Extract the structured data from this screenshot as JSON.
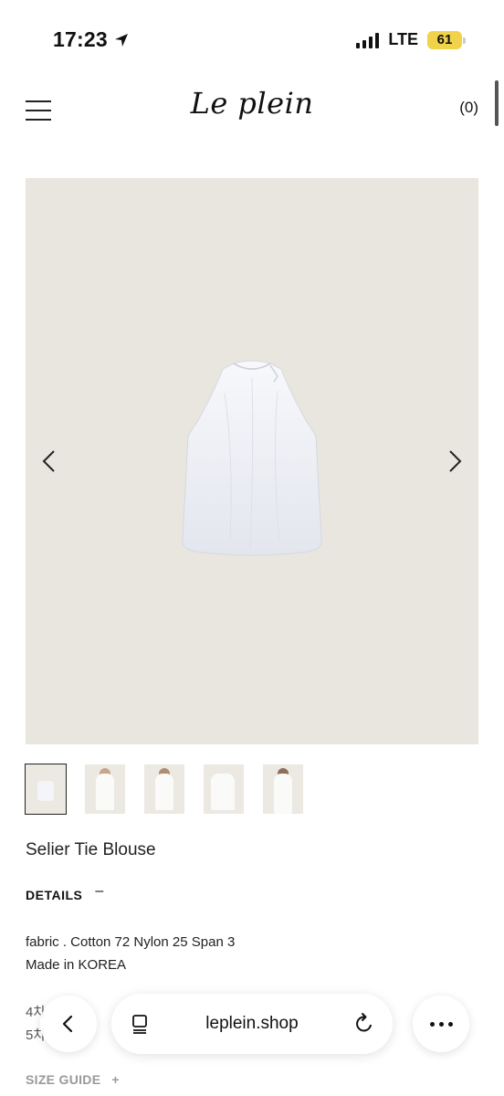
{
  "status": {
    "time": "17:23",
    "network": "LTE",
    "battery": "61"
  },
  "header": {
    "logo": "Le plein",
    "cart": "(0)"
  },
  "product": {
    "name": "Selier Tie Blouse",
    "details_label": "DETAILS",
    "details_toggle": "–",
    "fabric": "fabric . Cotton 72 Nylon 25 Span 3",
    "origin": "Made in KOREA",
    "line_4": "4차",
    "line_5": "5차",
    "size_guide": "SIZE GUIDE",
    "size_guide_toggle": "+"
  },
  "browser": {
    "url": "leplein.shop"
  },
  "colors": {
    "image_bg": "#e9e6df",
    "accent_battery": "#f1d34a"
  },
  "thumbnails_count": 5
}
